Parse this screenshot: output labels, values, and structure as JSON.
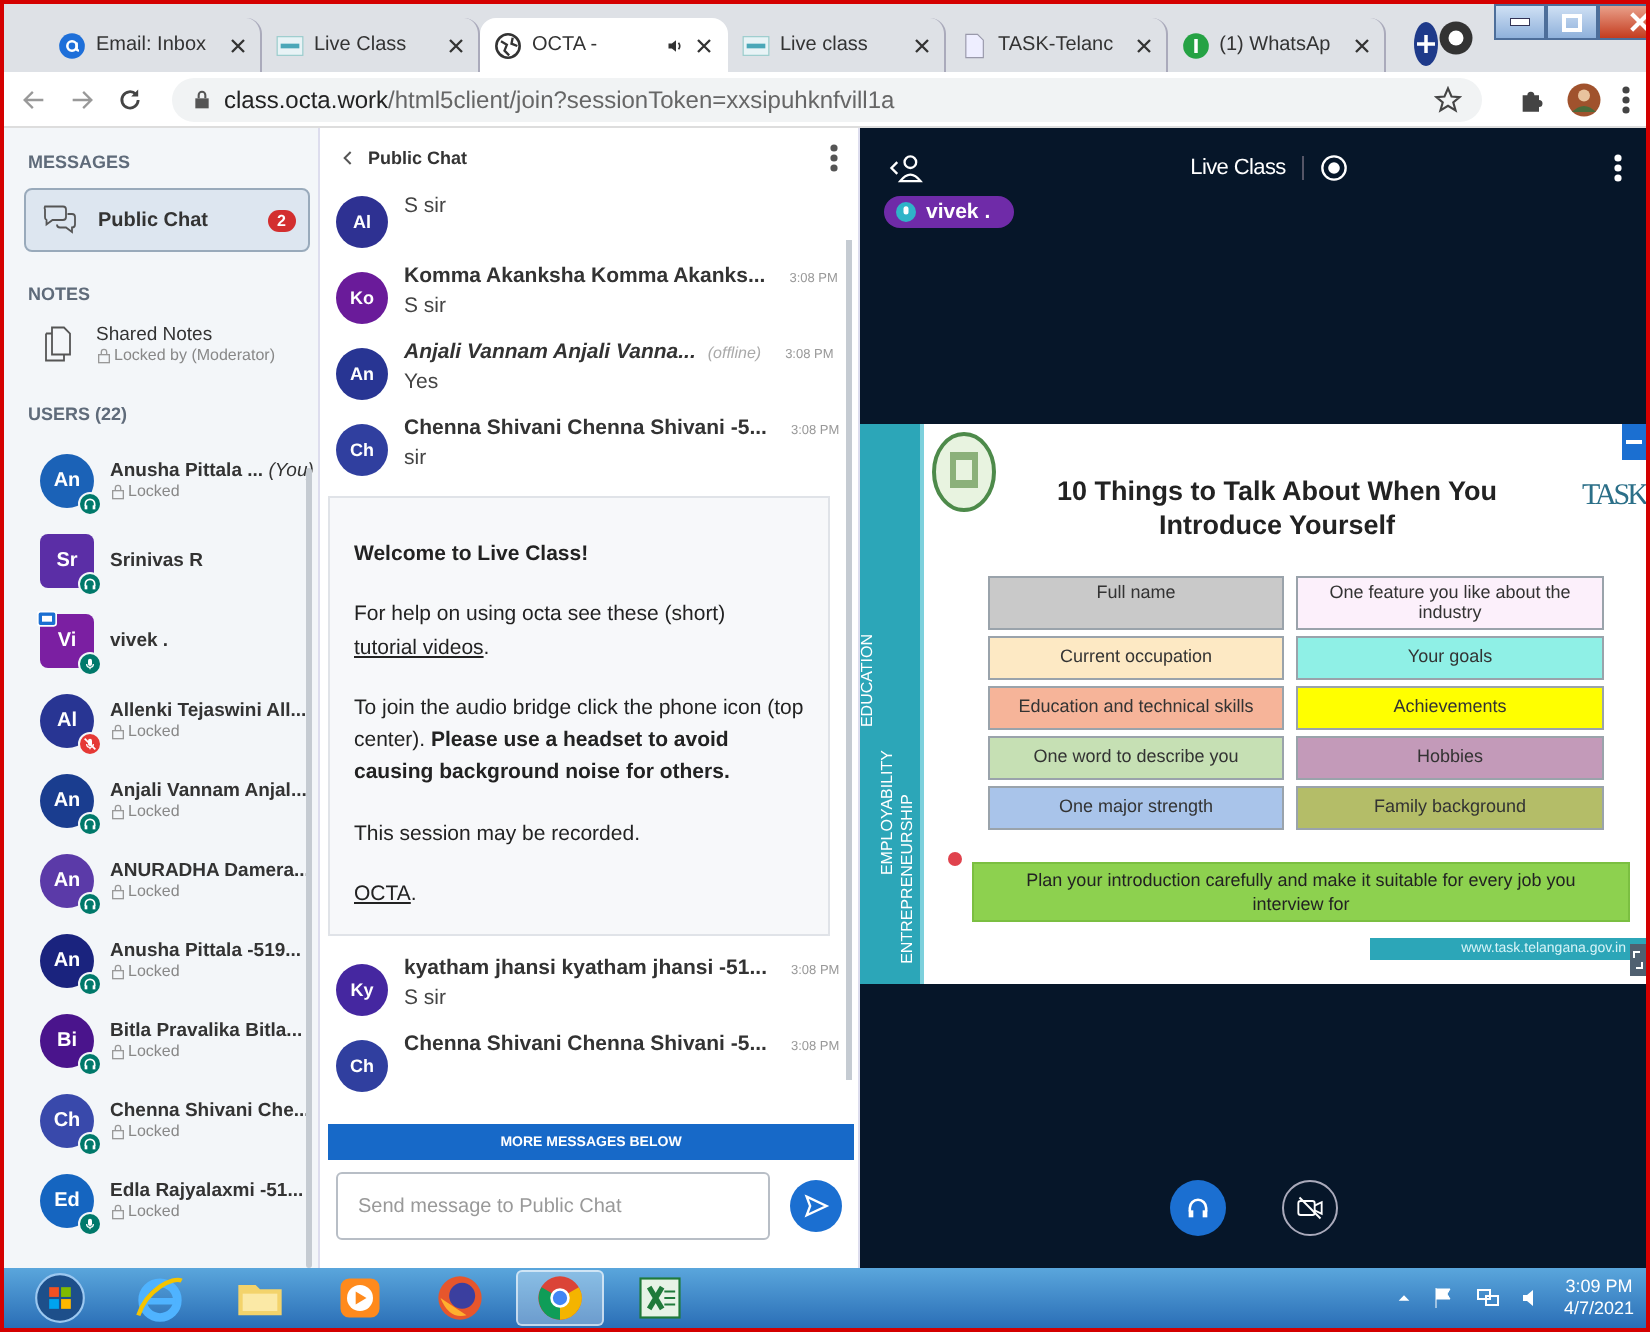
{
  "browser": {
    "tabs": [
      {
        "kind": "email",
        "title": "Email: Inbox",
        "selected": false,
        "audio": false
      },
      {
        "kind": "task",
        "title": "Live Class",
        "selected": false,
        "audio": false
      },
      {
        "kind": "globe",
        "title": "OCTA - ",
        "selected": true,
        "audio": true
      },
      {
        "kind": "task",
        "title": "Live class",
        "selected": false,
        "audio": false
      },
      {
        "kind": "doc",
        "title": "TASK-Telanc",
        "selected": false,
        "audio": false
      },
      {
        "kind": "whatsapp",
        "title": "(1) WhatsAp",
        "selected": false,
        "audio": false
      }
    ],
    "address": {
      "host": "class.octa.work",
      "path": "/html5client/join?sessionToken=xxsipuhknfvill1a"
    }
  },
  "sidebar": {
    "messages_heading": "MESSAGES",
    "public_chat": {
      "label": "Public Chat",
      "badge": "2",
      "selected": true
    },
    "notes_heading": "NOTES",
    "shared_notes": {
      "label": "Shared Notes",
      "status": "Locked by (Moderator)"
    },
    "users_heading": "USERS (22)",
    "users": [
      {
        "initials": "An",
        "name": "Anusha Pittala ...",
        "you": "(You)",
        "square": false,
        "color": "#1b62b7",
        "muted": false,
        "mic": false,
        "presenter": false,
        "locked": "Locked"
      },
      {
        "initials": "Sr",
        "name": "Srinivas R",
        "square": true,
        "color": "#5b2ea6",
        "muted": false,
        "mic": false,
        "presenter": false
      },
      {
        "initials": "Vi",
        "name": "vivek .",
        "square": true,
        "color": "#7b1fa2",
        "muted": false,
        "mic": true,
        "presenter": true
      },
      {
        "initials": "Al",
        "name": "Allenki Tejaswini All...",
        "square": false,
        "color": "#283593",
        "muted": true,
        "mic": true,
        "presenter": false,
        "locked": "Locked"
      },
      {
        "initials": "An",
        "name": "Anjali Vannam Anjal...",
        "square": false,
        "color": "#1a3d8f",
        "muted": false,
        "mic": false,
        "presenter": false,
        "locked": "Locked"
      },
      {
        "initials": "An",
        "name": "ANURADHA Damera...",
        "square": false,
        "color": "#5b3aa8",
        "muted": false,
        "mic": false,
        "presenter": false,
        "locked": "Locked"
      },
      {
        "initials": "An",
        "name": "Anusha Pittala -519...",
        "square": false,
        "color": "#1a237e",
        "muted": false,
        "mic": false,
        "presenter": false,
        "locked": "Locked"
      },
      {
        "initials": "Bi",
        "name": "Bitla Pravalika Bitla...",
        "square": false,
        "color": "#4a148c",
        "muted": false,
        "mic": false,
        "presenter": false,
        "locked": "Locked"
      },
      {
        "initials": "Ch",
        "name": "Chenna Shivani Che...",
        "square": false,
        "color": "#3949ab",
        "muted": false,
        "mic": false,
        "presenter": false,
        "locked": "Locked"
      },
      {
        "initials": "Ed",
        "name": "Edla Rajyalaxmi -51...",
        "square": false,
        "color": "#1565c0",
        "muted": false,
        "mic": true,
        "presenter": false,
        "locked": "Locked"
      }
    ]
  },
  "chat": {
    "title": "Public Chat",
    "feed": [
      {
        "kind": "message",
        "initials": "Al",
        "color": "#2e3192",
        "text": "S sir"
      },
      {
        "kind": "message",
        "initials": "Ko",
        "color": "#6a1b9a",
        "name": "Komma Akanksha Komma Akanks...",
        "time": "3:08 PM",
        "text": "S sir"
      },
      {
        "kind": "message",
        "initials": "An",
        "color": "#283593",
        "name": "Anjali Vannam Anjali Vanna...",
        "offline": "(offline)",
        "time": "3:08 PM",
        "text": "Yes"
      },
      {
        "kind": "message",
        "initials": "Ch",
        "color": "#303f9f",
        "name": "Chenna Shivani Chenna Shivani -5...",
        "time": "3:08 PM",
        "text": "sir"
      },
      {
        "kind": "welcome",
        "paragraphs": [
          [
            {
              "text": "Welcome to Live Class!",
              "bold": true
            }
          ],
          [
            {
              "text": "For help on using octa see these (short) "
            },
            {
              "text": "tutorial videos",
              "link": true
            },
            {
              "text": "."
            }
          ],
          [
            {
              "text": "To join the audio bridge click the phone icon (top center). "
            },
            {
              "text": "Please use a headset to avoid causing background noise for others.",
              "bold": true
            }
          ],
          [
            {
              "text": "This session may be recorded."
            }
          ],
          [
            {
              "text": "OCTA",
              "link": true
            },
            {
              "text": "."
            }
          ]
        ]
      },
      {
        "kind": "message",
        "initials": "Ky",
        "color": "#4527a0",
        "name": "kyatham jhansi kyatham jhansi -51...",
        "time": "3:08 PM",
        "text": "S sir"
      },
      {
        "kind": "message",
        "initials": "Ch",
        "color": "#303f9f",
        "name": "Chenna Shivani Chenna Shivani -5...",
        "time": "3:08 PM"
      }
    ],
    "more_messages": "MORE MESSAGES BELOW",
    "input": {
      "placeholder": "Send message to Public Chat"
    }
  },
  "presentation": {
    "title": "Live Class",
    "talker": "vivek .",
    "slide": {
      "side_labels": [
        "EDUCATION",
        "EMPLOYABILITY",
        "ENTREPRENEURSHIP"
      ],
      "title": "10 Things to Talk About When You Introduce Yourself",
      "logo": "TASK",
      "items": [
        {
          "text": "Full name",
          "color": "#c9c9c9"
        },
        {
          "text": "One feature you like about the industry",
          "color": "#fcf0fb"
        },
        {
          "text": "Current occupation",
          "color": "#fde9c4"
        },
        {
          "text": "Your goals",
          "color": "#8ff0e6"
        },
        {
          "text": "Education and technical skills",
          "color": "#f6b499"
        },
        {
          "text": "Achievements",
          "color": "#ffff00"
        },
        {
          "text": "One word to describe you",
          "color": "#c6e0b4"
        },
        {
          "text": "Hobbies",
          "color": "#c39ab9"
        },
        {
          "text": "One major strength",
          "color": "#a9c4ea"
        },
        {
          "text": "Family background",
          "color": "#b4bd68"
        }
      ],
      "banner": "Plan your introduction carefully and make it suitable for every job you interview for",
      "footer": "www.task.telangana.gov.in"
    }
  },
  "taskbar": {
    "apps": [
      {
        "kind": "ie",
        "active": false
      },
      {
        "kind": "folder",
        "active": false
      },
      {
        "kind": "media",
        "active": false
      },
      {
        "kind": "firefox",
        "active": false
      },
      {
        "kind": "chrome",
        "active": true
      },
      {
        "kind": "excel",
        "active": false
      }
    ],
    "time": "3:09 PM",
    "date": "4/7/2021"
  }
}
